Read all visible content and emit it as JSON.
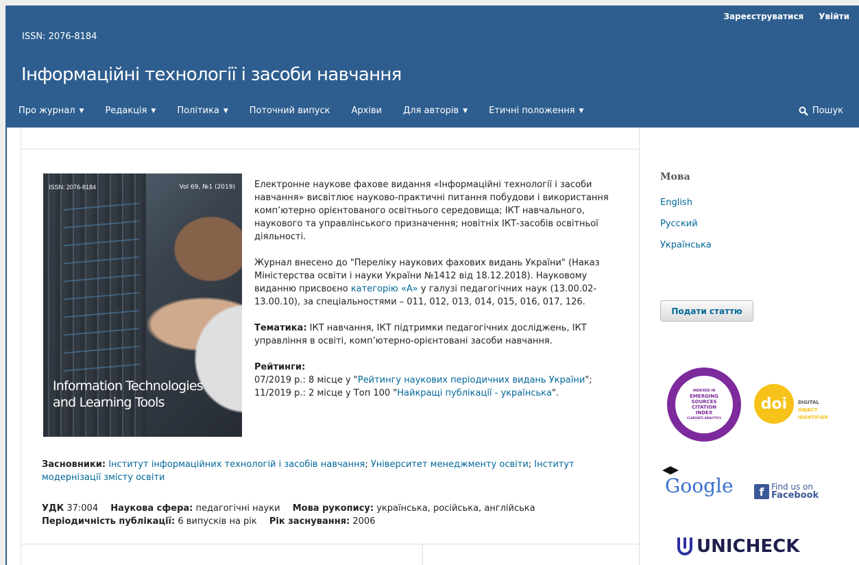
{
  "header": {
    "user_links": [
      "Зареєструватися",
      "Увійти"
    ],
    "issn": "ISSN: 2076-8184",
    "site_title": "Інформаційні технології і засоби навчання",
    "nav": [
      {
        "label": "Про журнал",
        "dropdown": true
      },
      {
        "label": "Редакція",
        "dropdown": true
      },
      {
        "label": "Політика",
        "dropdown": true
      },
      {
        "label": "Поточний випуск",
        "dropdown": false
      },
      {
        "label": "Архіви",
        "dropdown": false
      },
      {
        "label": "Для авторів",
        "dropdown": true
      },
      {
        "label": "Етичні положення",
        "dropdown": true
      }
    ],
    "search_label": "Пошук"
  },
  "cover": {
    "issn": "ISSN: 2076-8184",
    "volume": "Vol 69, №1 (2019)",
    "title_line1": "Information Technologies",
    "title_line2": "and Learning Tools"
  },
  "description": {
    "p1": "Електронне наукове фахове видання «Інформаційні технології і засоби навчання» висвітлює науково-практичні питання побудови і використання комп’ютерно орієнтованого освітнього середовища; ІКТ навчального, наукового та управлінського призначення; новітніх ІКТ-засобів освітньої діяльності.",
    "p2_before": "Журнал внесено до \"Переліку наукових фахових видань України\" (Наказ Міністерства освіти і науки України №1412 від 18.12.2018). Науковому виданню присвоєно ",
    "p2_link": "категорію «А»",
    "p2_after": " у галузі педагогічних наук (13.00.02-13.00.10), за спеціальностями – 011, 012, 013, 014, 015, 016, 017, 126.",
    "topics_label": "Тематика:",
    "topics_text": " ІКТ навчання, ІКТ підтримки педагогічних досліджень, ІКТ управління в освіті, комп’ютерно-орієнтовані засоби навчання.",
    "ratings_label": "Рейтинги:",
    "rating1_before": "07/2019 р.: 8 місце у \"",
    "rating1_link": "Рейтингу наукових періодичних видань України",
    "rating1_after": "\";",
    "rating2_before": "11/2019 р.: 2 місце у Топ 100 \"",
    "rating2_link": "Найкращі публікації - українська",
    "rating2_after": "\"."
  },
  "founders": {
    "label": "Засновники:",
    "items": [
      "Інститут інформаційних технологій і засобів навчання",
      "Університет менеджменту освіти",
      "Інститут модернізації змісту освіти"
    ]
  },
  "meta": {
    "udc_label": "УДК",
    "udc_value": " 37:004",
    "field_label": "Наукова сфера:",
    "field_value": " педагогічні науки",
    "lang_label": "Мова рукопису:",
    "lang_value": " українська, російська, англійська",
    "period_label": "Періодичність публікації:",
    "period_value": " 6 випусків на рік",
    "year_label": "Рік заснування:",
    "year_value": " 2006"
  },
  "sidebar": {
    "lang_title": "Мова",
    "languages": [
      "English",
      "Русский",
      "Українська"
    ],
    "submit_label": "Подати статтю",
    "esci": [
      "INDEXED IN",
      "EMERGING",
      "SOURCES",
      "CITATION",
      "INDEX",
      "CLARIVATE ANALYTICS"
    ],
    "doi": {
      "mark": "doi",
      "line1": "DIGITAL",
      "line2": "OBJECT",
      "line3": "IDENTIFIER"
    },
    "google": "Google",
    "facebook": {
      "line1": "Find us on",
      "line2": "Facebook"
    },
    "unicheck": "UNICHECK"
  },
  "colors": {
    "header_bg": "#2e5e8f",
    "link": "#006798",
    "esci": "#7d2a9c",
    "doi": "#f7c31a",
    "facebook": "#3b5998"
  }
}
